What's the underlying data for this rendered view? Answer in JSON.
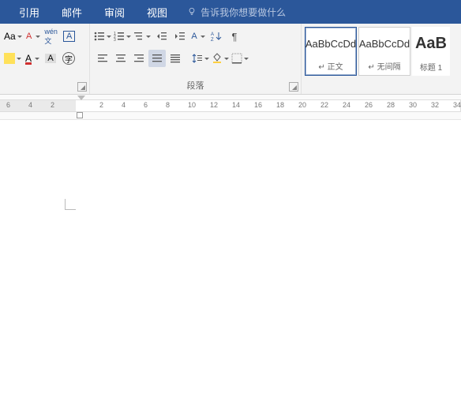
{
  "menu": {
    "references": "引用",
    "mail": "邮件",
    "review": "审阅",
    "view": "视图"
  },
  "tellme": "告诉我你想要做什么",
  "paragraph_label": "段落",
  "styles": {
    "body": {
      "preview": "AaBbCcDd",
      "name": "正文"
    },
    "nospacing": {
      "preview": "AaBbCcDd",
      "name": "无间隔"
    },
    "heading1": {
      "preview": "AaB",
      "name": "标题 1"
    }
  },
  "ruler_left": [
    "6",
    "4",
    "2"
  ],
  "ruler_right": [
    "2",
    "4",
    "6",
    "8",
    "10",
    "12",
    "14",
    "16",
    "18",
    "20",
    "22",
    "24",
    "26",
    "28",
    "30",
    "32",
    "34"
  ]
}
